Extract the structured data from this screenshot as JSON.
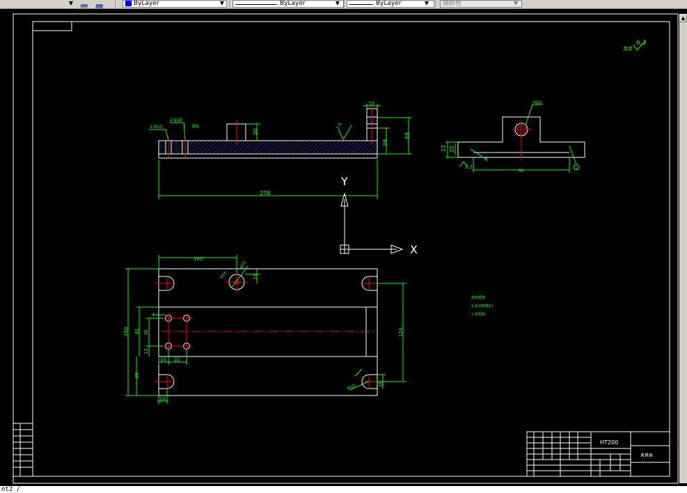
{
  "toolbar": {
    "color_select": "ByLayer",
    "linetype_select": "ByLayer",
    "lineweight_select": "ByLayer",
    "plotstyle_select": "随颜色",
    "color_swatch": "#0000ff"
  },
  "drawing": {
    "roughness_mark": "6.3",
    "roughness_note": "其余",
    "front_view": {
      "overall_length": "278",
      "height_right": "58",
      "height_inner": "36",
      "boss_height": "20",
      "top_step": "15",
      "hole_left": "2-M10",
      "hole_right": "2-φ10",
      "hole_right_note": "配钻",
      "surface_finish": "1.6"
    },
    "side_view": {
      "thread": "M16",
      "height_total": "22",
      "height_base": "20",
      "width": "80",
      "angle": "3.2",
      "dim_small": "5",
      "balloon": "1"
    },
    "top_view": {
      "dim_180": "180",
      "dim_160": "160",
      "dim_124": "124",
      "dim_61": "61",
      "dim_36": "36",
      "dim_12": "12",
      "dim_49": "49",
      "dim_10": "10",
      "dim_14": "14",
      "dim_22": "22",
      "dim_17": "17",
      "dim_r10": "R10",
      "dim_18": "18",
      "hole_note": "φ16",
      "hole_note2": "φ25",
      "hole_label": "4"
    },
    "ucs": {
      "x_label": "X",
      "y_label": "Y"
    },
    "tech_requirements": {
      "title": "技术要求",
      "line1": "1.未注倒角C2",
      "line2": "2.去毛刺"
    },
    "title_block": {
      "material": "HT200",
      "part_name": "夹具体"
    }
  },
  "command_line": {
    "text": "nt2 /"
  },
  "colors": {
    "background": "#000000",
    "geometry": "#ffffff",
    "dimension": "#00ff00",
    "centerline": "#ff0000",
    "hatch": "#4040ff",
    "toolbar": "#d4d0c8"
  }
}
